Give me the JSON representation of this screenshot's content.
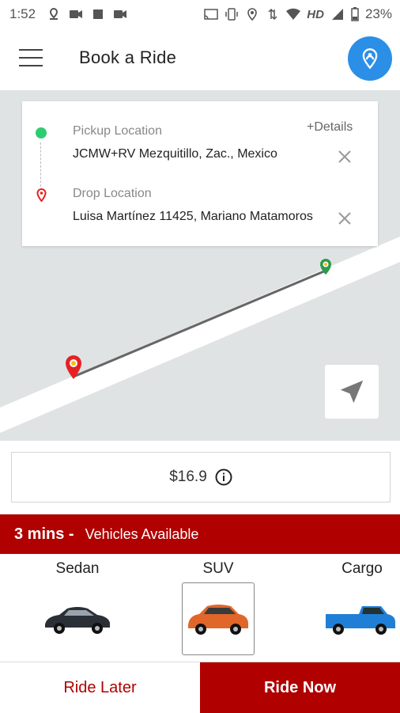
{
  "status_bar": {
    "time": "1:52",
    "network": "HD",
    "battery": "23%",
    "icons_left": [
      "location-pin-icon",
      "video-camera-icon",
      "stop-square-icon",
      "video-camera-icon"
    ],
    "icons_right": [
      "cast-icon",
      "vibrate-icon",
      "location-icon",
      "data-arrows-icon",
      "wifi-icon",
      "signal-icon",
      "battery-icon"
    ]
  },
  "header": {
    "title": "Book a Ride",
    "menu_icon": "hamburger-icon",
    "location_icon": "person-location-icon",
    "accent": "#2b8fe8"
  },
  "route_card": {
    "pickup_label": "Pickup Location",
    "pickup_value": "JCMW+RV Mezquitillo, Zac., Mexico",
    "drop_label": "Drop Location",
    "drop_value": "Luisa Martínez 11425, Mariano Matamoros",
    "details_label": "+Details",
    "pickup_color": "#2ecc71",
    "drop_color": "#e52222"
  },
  "fare": {
    "amount": "$16.9",
    "info_icon": "info-icon"
  },
  "availability": {
    "time": "3 mins -",
    "text": "Vehicles Available",
    "color": "#b00000"
  },
  "vehicles": [
    {
      "name": "Sedan",
      "selected": false,
      "icon": "sedan-car-icon"
    },
    {
      "name": "SUV",
      "selected": true,
      "icon": "suv-car-icon"
    },
    {
      "name": "Cargo",
      "selected": false,
      "icon": "pickup-truck-icon"
    }
  ],
  "actions": {
    "ride_later": "Ride Later",
    "ride_now": "Ride Now"
  }
}
